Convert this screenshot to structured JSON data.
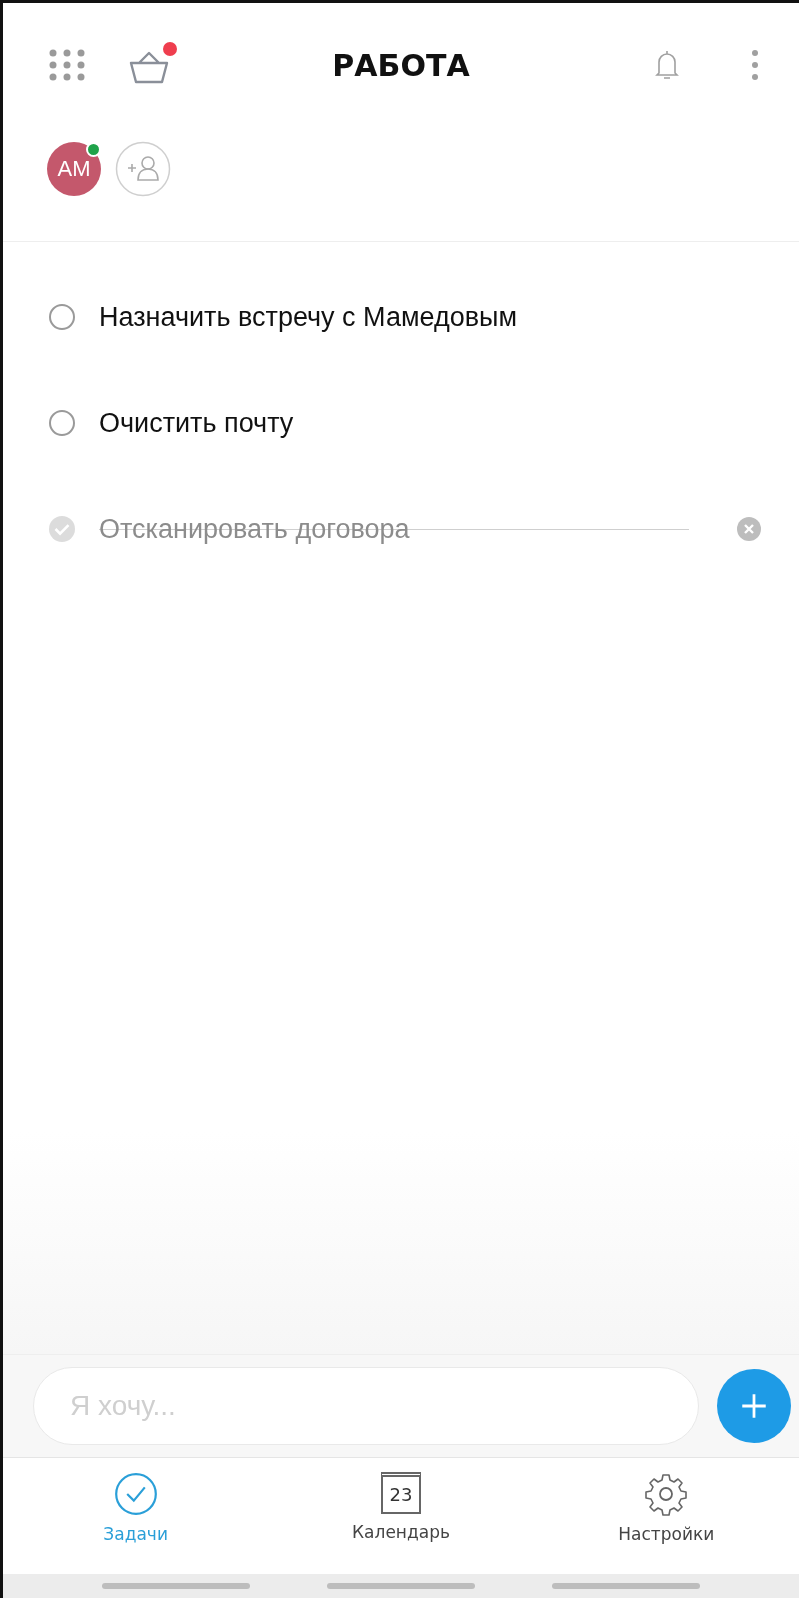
{
  "header": {
    "title": "РАБОТА",
    "basket_badge": true
  },
  "members": {
    "avatar_initials": "АМ",
    "avatar_online": true
  },
  "tasks": [
    {
      "title": "Назначить встречу с Мамедовым",
      "checked": false
    },
    {
      "title": "Очистить почту",
      "checked": false
    },
    {
      "title": "Отсканировать договора",
      "checked": true
    }
  ],
  "composer": {
    "placeholder": "Я хочу..."
  },
  "nav": [
    {
      "label": "Задачи",
      "kind": "tasks",
      "selected": true
    },
    {
      "label": "Календарь",
      "kind": "calendar",
      "selected": false,
      "icon_text": "23"
    },
    {
      "label": "Настройки",
      "kind": "settings",
      "selected": false
    }
  ]
}
